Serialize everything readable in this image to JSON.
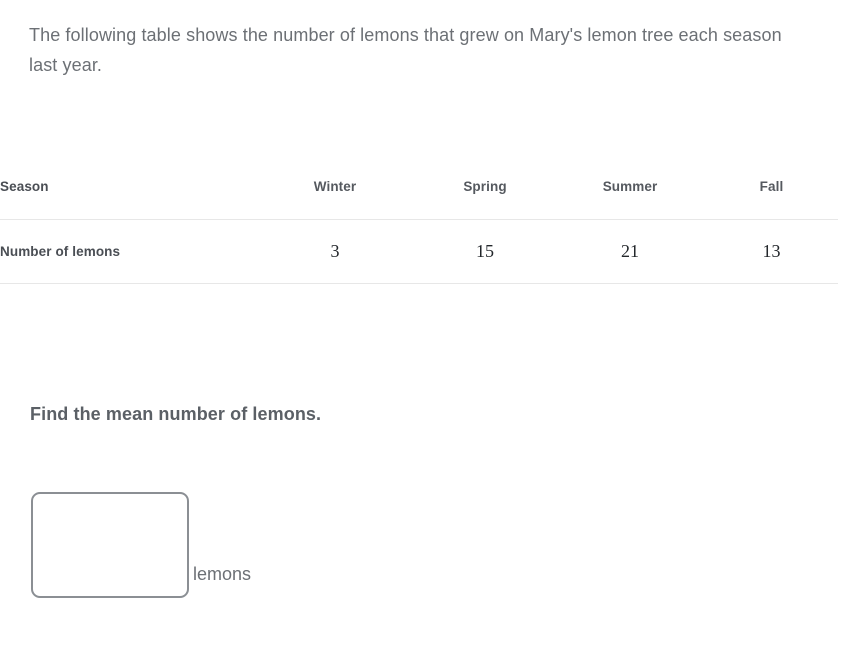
{
  "problem": {
    "intro": "The following table shows the number of lemons that grew on Mary's lemon tree each season last year.",
    "prompt": "Find the mean number of lemons."
  },
  "table": {
    "row_labels": {
      "header": "Season",
      "data": "Number of lemons"
    },
    "columns": [
      "Winter",
      "Spring",
      "Summer",
      "Fall"
    ],
    "values": [
      "3",
      "15",
      "21",
      "13"
    ]
  },
  "answer": {
    "value": "",
    "placeholder": "",
    "unit": "lemons"
  },
  "colors": {
    "text_body": "#6c7075",
    "text_strong": "#4a4e54",
    "rule": "#e7e7e7",
    "input_border": "#8b8f94",
    "background": "#ffffff"
  }
}
